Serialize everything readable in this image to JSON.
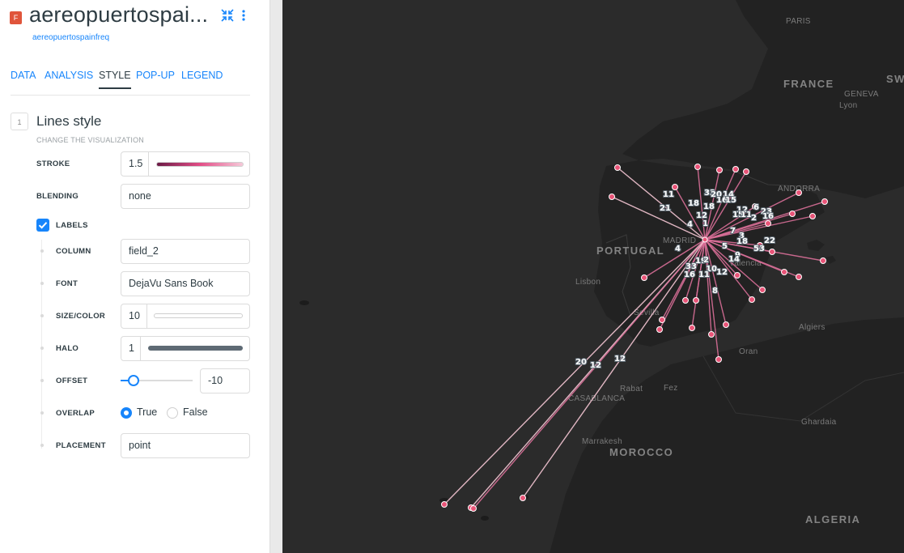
{
  "layer": {
    "badge": "F",
    "title": "aereopuertospai...",
    "subtitle": "aereopuertospainfreq",
    "icons": [
      "collapse-icon",
      "more-vertical-icon"
    ]
  },
  "tabs": [
    "DATA",
    "ANALYSIS",
    "STYLE",
    "POP-UP",
    "LEGEND"
  ],
  "active_tab": "STYLE",
  "section": {
    "number": "1",
    "title": "Lines style",
    "subtitle": "CHANGE THE VISUALIZATION"
  },
  "fields": {
    "stroke": {
      "label": "STROKE",
      "value": "1.5",
      "ramp_colors": [
        "#6b1a45",
        "#e24d86",
        "#f6c9d9"
      ]
    },
    "blending": {
      "label": "BLENDING",
      "value": "none"
    },
    "labels": {
      "label": "LABELS",
      "checked": true
    },
    "column": {
      "label": "COLUMN",
      "value": "field_2"
    },
    "font": {
      "label": "FONT",
      "value": "DejaVu Sans Book"
    },
    "size_color": {
      "label": "SIZE/COLOR",
      "value": "10",
      "color": "#ffffff"
    },
    "halo": {
      "label": "HALO",
      "value": "1",
      "color": "#5e6a74"
    },
    "offset": {
      "label": "OFFSET",
      "value": "-10",
      "slider_fraction": 0.18
    },
    "overlap": {
      "label": "OVERLAP",
      "options": [
        "True",
        "False"
      ],
      "selected": "True"
    },
    "placement": {
      "label": "PLACEMENT",
      "value": "point"
    }
  },
  "map": {
    "places": [
      "PARIS",
      "FRANCE",
      "GENEVA",
      "Lyon",
      "SW",
      "ANDORRA",
      "PORTUGAL",
      "MADRID",
      "Valencia",
      "Lisbon",
      "Sevilla",
      "Algiers",
      "Oran",
      "Rabat",
      "Fez",
      "CASABLANCA",
      "Marrakesh",
      "MOROCCO",
      "Ghardaia",
      "ALGERIA"
    ],
    "line_labels": [
      "33",
      "2",
      "0",
      "14",
      "16",
      "15",
      "11",
      "18",
      "21",
      "12",
      "18",
      "12",
      "6",
      "15",
      "11",
      "23",
      "2",
      "16",
      "4",
      "1",
      "7",
      "3",
      "18",
      "22",
      "4",
      "5",
      "53",
      "9",
      "14",
      "19",
      "2",
      "33",
      "10",
      "16",
      "11",
      "12",
      "8",
      "20",
      "12",
      "12"
    ],
    "colors": {
      "line": "#d96f98",
      "line_light": "#f5c7d4",
      "point": "#e95478",
      "point_stroke": "#ffffff",
      "land": "#262626",
      "sea": "#2b2b2b"
    }
  }
}
